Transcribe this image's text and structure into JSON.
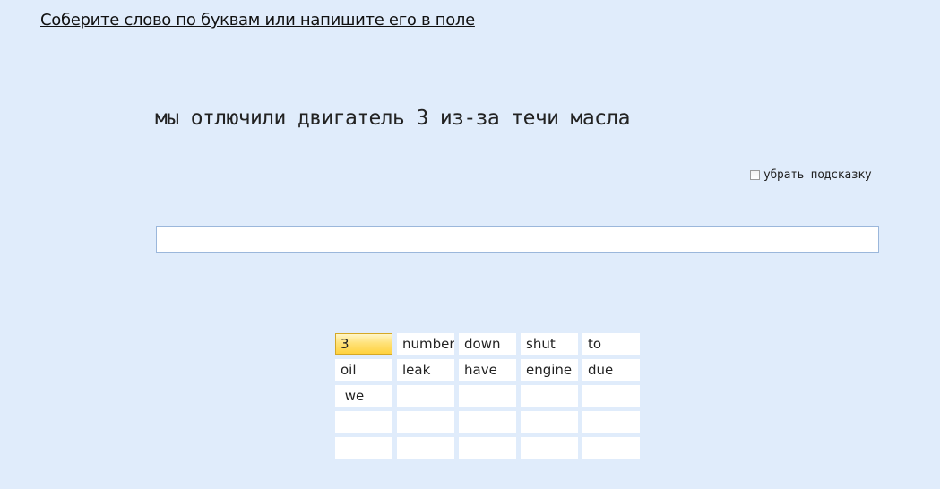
{
  "instruction": "Соберите слово по буквам или напишите его в поле",
  "sentence": "мы отлючили двигатель 3 из-за течи масла",
  "hint_toggle": {
    "label": "убрать подсказку",
    "checked": false
  },
  "answer_input": {
    "value": "",
    "placeholder": ""
  },
  "tiles": [
    {
      "text": "3",
      "selected": true
    },
    {
      "text": "number",
      "selected": false
    },
    {
      "text": "down",
      "selected": false
    },
    {
      "text": "shut",
      "selected": false
    },
    {
      "text": "to",
      "selected": false
    },
    {
      "text": "oil",
      "selected": false
    },
    {
      "text": "leak",
      "selected": false
    },
    {
      "text": "have",
      "selected": false
    },
    {
      "text": "engine",
      "selected": false
    },
    {
      "text": "due",
      "selected": false
    },
    {
      "text": " we",
      "selected": false
    },
    {
      "text": "",
      "selected": false
    },
    {
      "text": "",
      "selected": false
    },
    {
      "text": "",
      "selected": false
    },
    {
      "text": "",
      "selected": false
    },
    {
      "text": "",
      "selected": false
    },
    {
      "text": "",
      "selected": false
    },
    {
      "text": "",
      "selected": false
    },
    {
      "text": "",
      "selected": false
    },
    {
      "text": "",
      "selected": false
    },
    {
      "text": "",
      "selected": false
    },
    {
      "text": "",
      "selected": false
    },
    {
      "text": "",
      "selected": false
    },
    {
      "text": "",
      "selected": false
    },
    {
      "text": "",
      "selected": false
    }
  ],
  "colors": {
    "background": "#e0ecfb",
    "tile": "#ffffff",
    "selected_tile": "#ffd23f",
    "input_border": "#9bb7db"
  }
}
